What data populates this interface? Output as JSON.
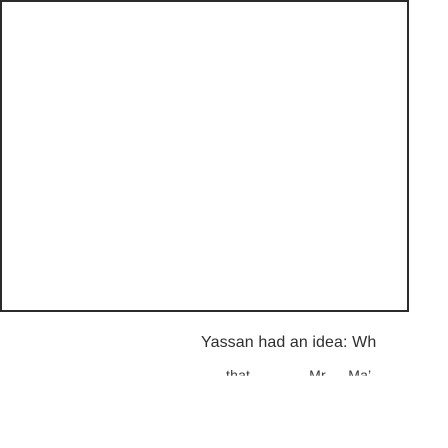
{
  "caption": {
    "line1": "Yassan had an idea: Wh",
    "line2": "that …  … … Mr …  Ma’ …"
  },
  "colors": {
    "frame_border": "#2b2b2b",
    "background": "#ffffff",
    "text": "#2e2e2e"
  }
}
